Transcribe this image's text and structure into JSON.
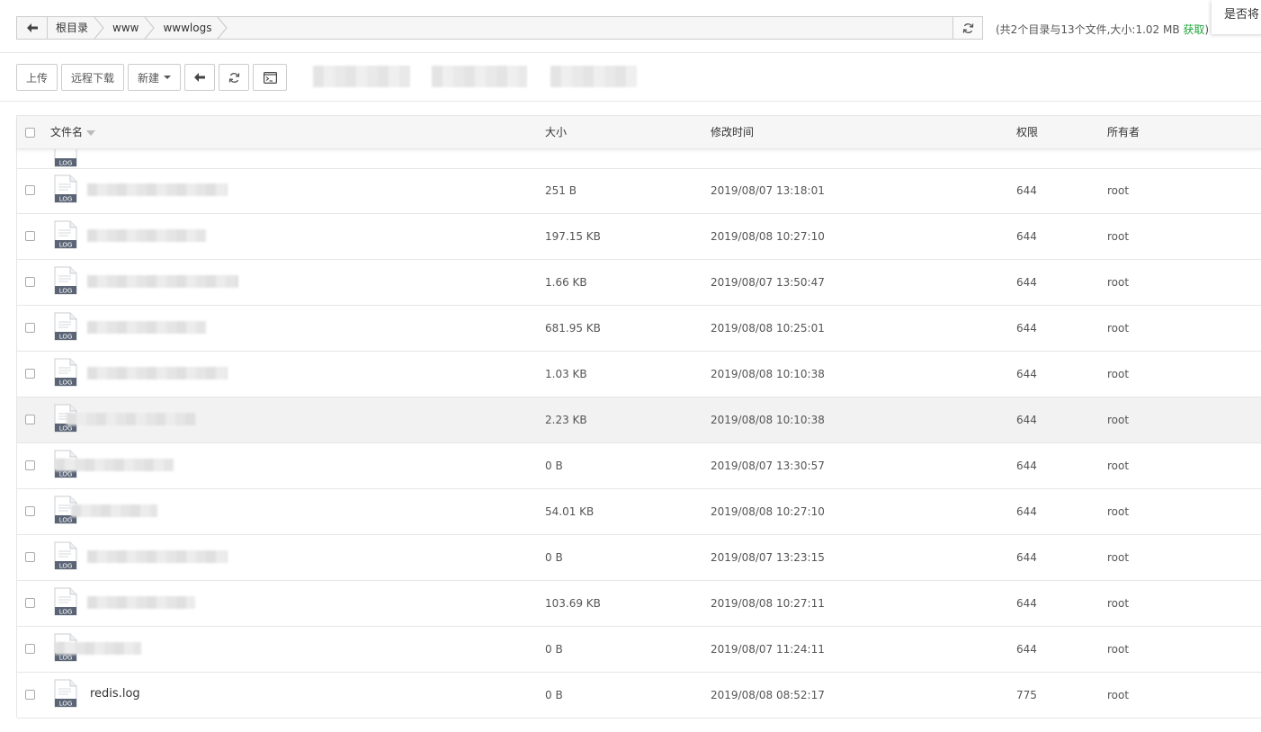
{
  "breadcrumb": {
    "items": [
      "根目录",
      "www",
      "wwwlogs"
    ]
  },
  "summary": {
    "text": "(共2个目录与13个文件,大小:1.02 MB",
    "fetch": "获取",
    "close": ")"
  },
  "corner_tip": "是否将",
  "toolbar": {
    "upload": "上传",
    "remote_download": "远程下载",
    "new": "新建"
  },
  "table": {
    "columns": {
      "name": "文件名",
      "size": "大小",
      "mtime": "修改时间",
      "perm": "权限",
      "owner": "所有者"
    },
    "icon_label": "LOG",
    "rows": [
      {
        "size": "251 B",
        "mtime": "2019/08/07 13:18:01",
        "perm": "644",
        "owner": "root"
      },
      {
        "size": "197.15 KB",
        "mtime": "2019/08/08 10:27:10",
        "perm": "644",
        "owner": "root"
      },
      {
        "size": "1.66 KB",
        "mtime": "2019/08/07 13:50:47",
        "perm": "644",
        "owner": "root"
      },
      {
        "size": "681.95 KB",
        "mtime": "2019/08/08 10:25:01",
        "perm": "644",
        "owner": "root"
      },
      {
        "size": "1.03 KB",
        "mtime": "2019/08/08 10:10:38",
        "perm": "644",
        "owner": "root"
      },
      {
        "size": "2.23 KB",
        "mtime": "2019/08/08 10:10:38",
        "perm": "644",
        "owner": "root"
      },
      {
        "size": "0 B",
        "mtime": "2019/08/07 13:30:57",
        "perm": "644",
        "owner": "root"
      },
      {
        "size": "54.01 KB",
        "mtime": "2019/08/08 10:27:10",
        "perm": "644",
        "owner": "root"
      },
      {
        "size": "0 B",
        "mtime": "2019/08/07 13:23:15",
        "perm": "644",
        "owner": "root"
      },
      {
        "size": "103.69 KB",
        "mtime": "2019/08/08 10:27:11",
        "perm": "644",
        "owner": "root"
      },
      {
        "size": "0 B",
        "mtime": "2019/08/07 11:24:11",
        "perm": "644",
        "owner": "root"
      },
      {
        "name": "redis.log",
        "size": "0 B",
        "mtime": "2019/08/08 08:52:17",
        "perm": "775",
        "owner": "root"
      }
    ]
  },
  "colors": {
    "accent": "#20a53a",
    "border": "#cccccc",
    "icon_badge": "#5a6475"
  }
}
